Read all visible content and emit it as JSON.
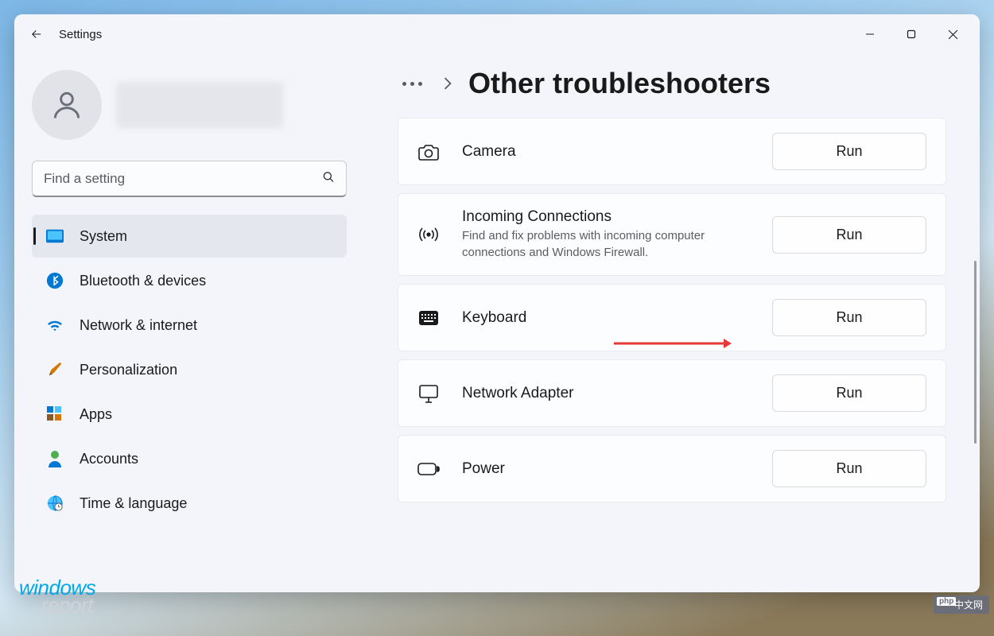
{
  "window": {
    "title": "Settings"
  },
  "search": {
    "placeholder": "Find a setting"
  },
  "nav": {
    "items": [
      {
        "label": "System"
      },
      {
        "label": "Bluetooth & devices"
      },
      {
        "label": "Network & internet"
      },
      {
        "label": "Personalization"
      },
      {
        "label": "Apps"
      },
      {
        "label": "Accounts"
      },
      {
        "label": "Time & language"
      }
    ]
  },
  "page": {
    "title": "Other troubleshooters"
  },
  "troubleshooters": [
    {
      "title": "Camera",
      "desc": "",
      "run": "Run"
    },
    {
      "title": "Incoming Connections",
      "desc": "Find and fix problems with incoming computer connections and Windows Firewall.",
      "run": "Run"
    },
    {
      "title": "Keyboard",
      "desc": "",
      "run": "Run"
    },
    {
      "title": "Network Adapter",
      "desc": "",
      "run": "Run"
    },
    {
      "title": "Power",
      "desc": "",
      "run": "Run"
    }
  ],
  "watermark": {
    "line1": "windows",
    "line2": "report",
    "tag": "中文网"
  }
}
